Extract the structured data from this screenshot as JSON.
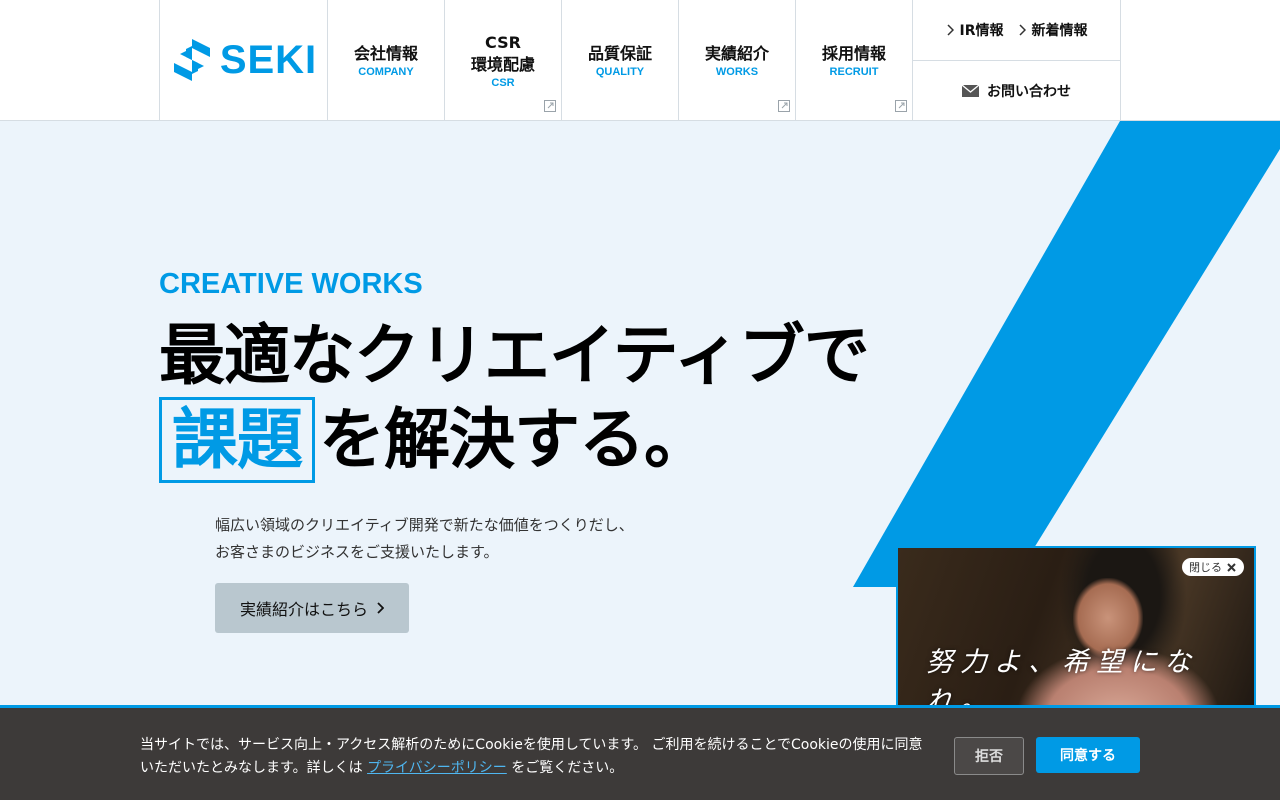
{
  "header": {
    "logo_text": "SEKI",
    "nav": [
      {
        "jp": "会社情報",
        "en": "COMPANY",
        "external": false
      },
      {
        "jp": "CSR\n環境配慮",
        "en": "CSR",
        "external": true
      },
      {
        "jp": "品質保証",
        "en": "QUALITY",
        "external": false
      },
      {
        "jp": "実績紹介",
        "en": "WORKS",
        "external": true
      },
      {
        "jp": "採用情報",
        "en": "RECRUIT",
        "external": true
      }
    ],
    "ir_label": "IR情報",
    "news_label": "新着情報",
    "contact_label": "お問い合わせ"
  },
  "hero": {
    "eyebrow": "CREATIVE WORKS",
    "headline_line1": "最適なクリエイティブで",
    "headline_highlight": "課題",
    "headline_line2_rest": "を解決する。",
    "lead_line1": "幅広い領域のクリエイティブ開発で新たな価値をつくりだし、",
    "lead_line2": "お客さまのビジネスをご支援いたします。",
    "cta_label": "実績紹介はこちら"
  },
  "video_popup": {
    "caption": "努力よ、希望になれ。",
    "close_label": "閉じる"
  },
  "cookie": {
    "text_before": "当サイトでは、サービス向上・アクセス解析のためにCookieを使用しています。 ご利用を続けることでCookieの使用に同意いただいたとみなします。詳しくは ",
    "link_label": "プライバシーポリシー",
    "text_after": " をご覧ください。",
    "decline_label": "拒否",
    "accept_label": "同意する"
  },
  "colors": {
    "accent": "#009ae5",
    "hero_bg": "#ecf4fb",
    "cookie_bg": "#3d3a39"
  }
}
